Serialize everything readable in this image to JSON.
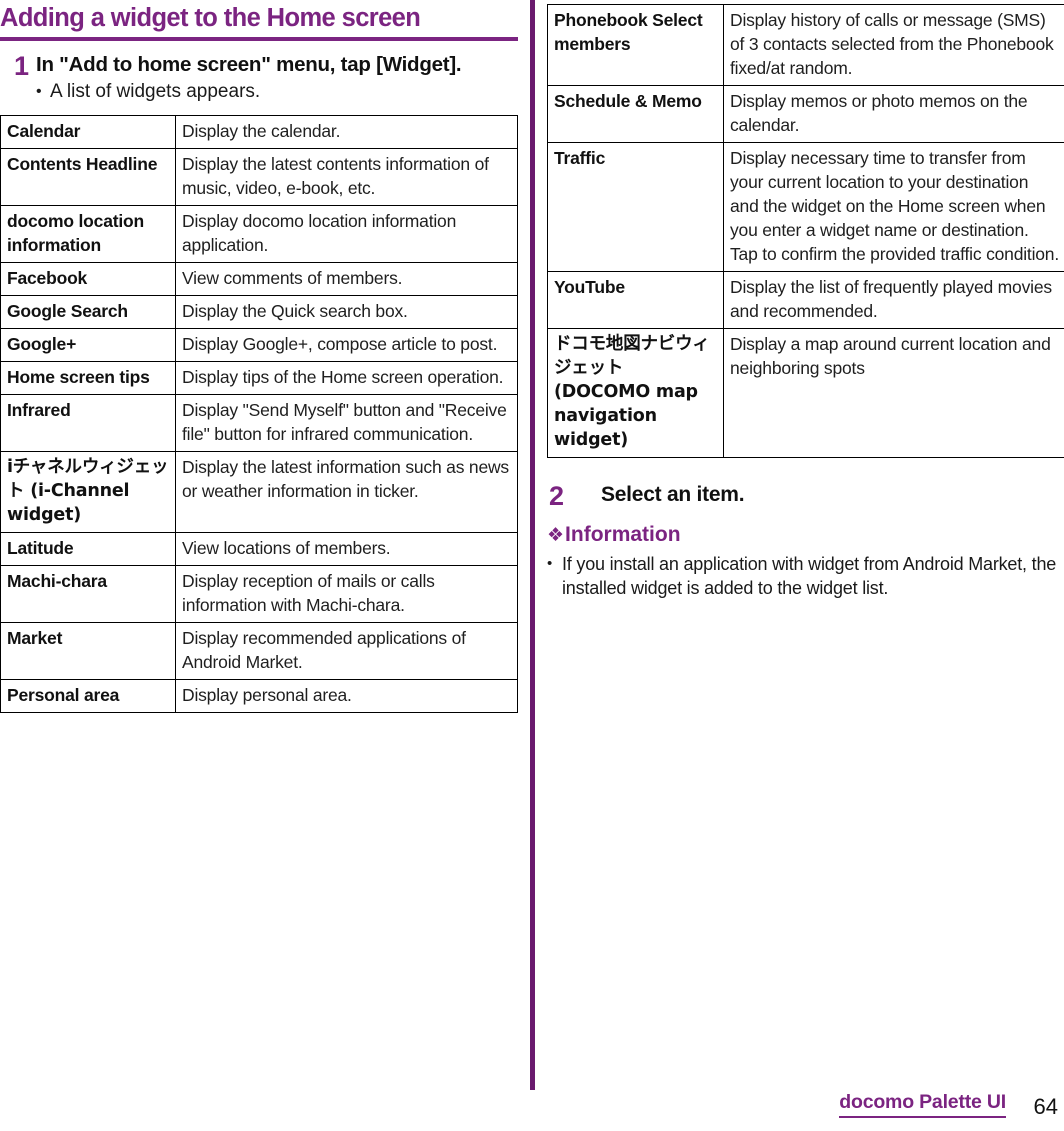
{
  "page": {
    "title": "Adding a widget to the Home screen",
    "footer_chapter": "docomo Palette UI",
    "footer_page": "64",
    "accent_color": "#7b2481",
    "divider_color": "#6a1a6e",
    "text_color": "#1a1a1a"
  },
  "steps": [
    {
      "number": "1",
      "text": "In \"Add to home screen\" menu, tap [Widget].",
      "bullet_marker": "•",
      "sub": "A list of widgets appears."
    },
    {
      "number": "2",
      "text": "Select an item."
    }
  ],
  "left_table": {
    "rows": [
      {
        "name": "Calendar",
        "desc": "Display the calendar."
      },
      {
        "name": "Contents Headline",
        "desc": "Display the latest contents information of music, video, e-book, etc."
      },
      {
        "name": "docomo location information",
        "desc": "Display docomo location information application."
      },
      {
        "name": "Facebook",
        "desc": "View comments of members."
      },
      {
        "name": "Google Search",
        "desc": "Display the Quick search box."
      },
      {
        "name": "Google+",
        "desc": "Display Google+, compose article to post."
      },
      {
        "name": "Home screen tips",
        "desc": "Display tips of the Home screen operation."
      },
      {
        "name": "Infrared",
        "desc": "Display \"Send Myself\" button and \"Receive file\" button for infrared communication."
      },
      {
        "name": "iチャネルウィジェット (i-Channel widget)",
        "desc": "Display the latest information such as news or weather information in ticker."
      },
      {
        "name": "Latitude",
        "desc": "View locations of members."
      },
      {
        "name": "Machi-chara",
        "desc": "Display reception of mails or calls information with Machi-chara."
      },
      {
        "name": "Market",
        "desc": "Display recommended applications of Android Market."
      },
      {
        "name": "Personal area",
        "desc": "Display personal area."
      }
    ]
  },
  "right_table": {
    "rows": [
      {
        "name": "Phonebook Select members",
        "desc": "Display history of calls or message (SMS) of 3 contacts selected from the Phonebook fixed/at random."
      },
      {
        "name": "Schedule & Memo",
        "desc": "Display memos or photo memos on the calendar."
      },
      {
        "name": "Traffic",
        "desc": "Display necessary time to transfer from your current location to your destination and the widget on the Home screen when you enter a widget name or destination. Tap to confirm the provided traffic condition."
      },
      {
        "name": "YouTube",
        "desc": "Display the list of frequently played movies and recommended."
      },
      {
        "name": "ドコモ地図ナビウィジェット (DOCOMO map navigation widget)",
        "desc": "Display a map around current location and neighboring spots"
      }
    ]
  },
  "information": {
    "marker": "❖",
    "heading": "Information",
    "bullet_marker": "•",
    "items": [
      "If you install an application with widget from Android Market, the installed widget is added to the widget list."
    ]
  }
}
